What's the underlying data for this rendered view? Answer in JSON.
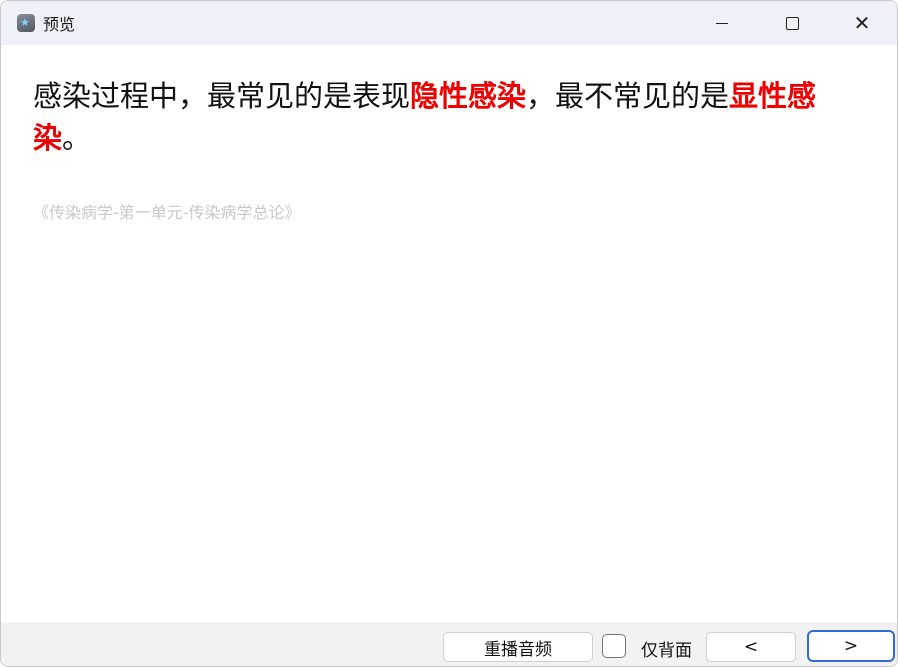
{
  "window": {
    "title": "预览",
    "app_icon": "star-app-icon",
    "controls": {
      "minimize": "minimize-icon",
      "maximize": "maximize-icon",
      "close": "close-icon"
    }
  },
  "content": {
    "question_parts": [
      {
        "text": "感染过程中，最常见的是表现",
        "highlight": false
      },
      {
        "text": "隐性感染",
        "highlight": true
      },
      {
        "text": "，最不常见的是",
        "highlight": false
      },
      {
        "text": "显性感染",
        "highlight": true
      },
      {
        "text": "。",
        "highlight": false
      }
    ],
    "source": "《传染病学-第一单元-传染病学总论》",
    "highlight_color": "#ee0000"
  },
  "bottombar": {
    "replay_label": "重播音频",
    "back_only_label": "仅背面",
    "back_only_checked": false,
    "prev_label": "<",
    "next_label": ">"
  }
}
